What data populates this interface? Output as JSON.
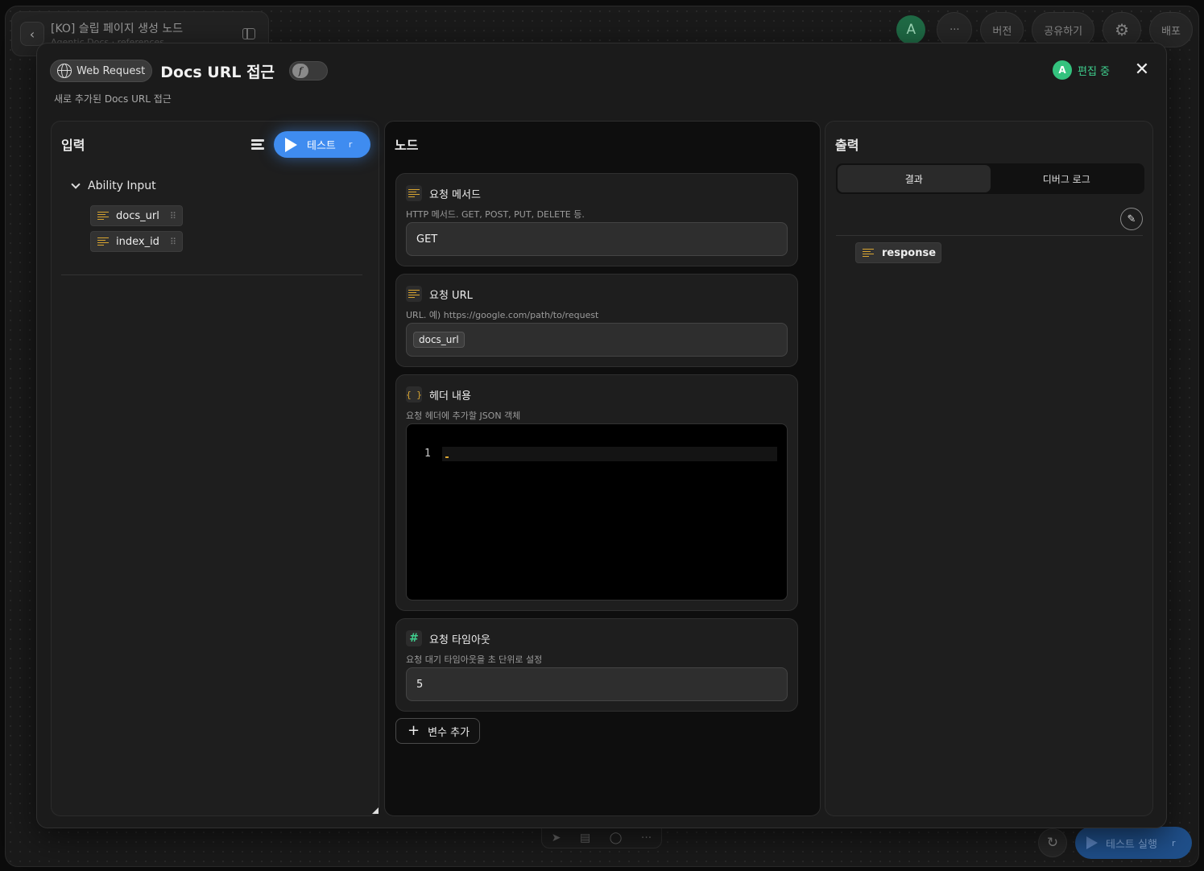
{
  "project": {
    "title": "[KO] 슬립 페이지 생성 노드",
    "subtitle": "Agentic Docs · references"
  },
  "topbar": {
    "avatar": "A",
    "more": "···",
    "version": "버전",
    "share": "공유하기",
    "deploy": "배포"
  },
  "modal": {
    "type_badge": "Web Request",
    "title": "Docs URL 접근",
    "fn_toggle": "f",
    "subtitle": "새로 추가된 Docs URL 접근",
    "editing": {
      "avatar": "A",
      "label": "편집 중"
    },
    "close": "✕"
  },
  "input_panel": {
    "title": "입력",
    "test_button": {
      "label": "테스트",
      "shortcut": "r"
    },
    "group": "Ability Input",
    "variables": [
      {
        "name": "docs_url"
      },
      {
        "name": "index_id"
      }
    ]
  },
  "node_panel": {
    "title": "노드",
    "fields": [
      {
        "label": "요청 메서드",
        "icon": "text-icon",
        "description": "HTTP 메서드. GET, POST, PUT, DELETE 등.",
        "value": "GET"
      },
      {
        "label": "요청 URL",
        "icon": "text-icon",
        "description": "URL. 예) https://google.com/path/to/request",
        "chip": "docs_url"
      },
      {
        "label": "헤더 내용",
        "icon": "braces-icon",
        "description": "요청 헤더에 추가할 JSON 객체",
        "line_number": "1"
      },
      {
        "label": "요청 타임아웃",
        "icon": "hash-icon",
        "description": "요청 대기 타임아웃을 초 단위로 설정",
        "value": "5"
      }
    ],
    "add_variable": "변수 추가"
  },
  "output_panel": {
    "title": "출력",
    "tabs": [
      {
        "label": "결과",
        "active": true
      },
      {
        "label": "디버그 로그",
        "active": false
      }
    ],
    "outputs": [
      {
        "name": "response"
      }
    ]
  },
  "bottom": {
    "run_test": "테스트 실행",
    "shortcut": "r"
  },
  "colors": {
    "accent": "#3f8cf0",
    "editing": "#3fcf8e",
    "text_icon": "#d9a531"
  }
}
